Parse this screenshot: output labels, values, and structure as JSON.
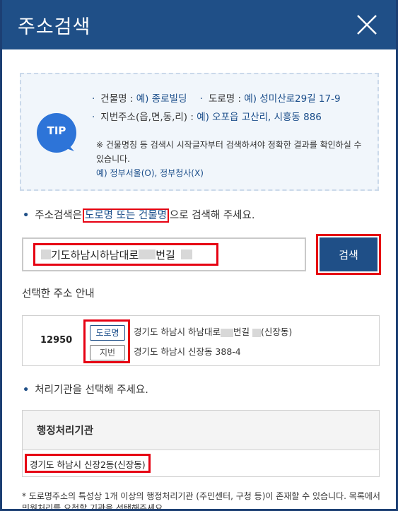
{
  "header": {
    "title": "주소검색"
  },
  "tip": {
    "badge": "TIP",
    "line1_label1": "건물명 :",
    "line1_ex1": "예) 종로빌딩",
    "line1_label2": "도로명 :",
    "line1_ex2": "예) 성미산로29길 17-9",
    "line2_label": "지번주소(읍,면,동,리) :",
    "line2_ex": "예) 오포읍 고산리, 시흥동 886",
    "note": "※ 건물명칭 등 검색시 시작글자부터 검색하셔야 정확한 결과를 확인하실 수 있습니다.",
    "example": "예) 정부서울(O), 정부청사(X)"
  },
  "guide": {
    "prefix": "주소검색은",
    "highlight": "도로명 또는 건물명",
    "suffix": "으로 검색해 주세요."
  },
  "search": {
    "value_a": "기도하남시하남대로",
    "value_b": "번길",
    "button_label": "검색"
  },
  "selected": {
    "title": "선택한 주소 안내",
    "zip": "12950",
    "road_tag": "도로명",
    "lot_tag": "지번",
    "road_addr_a": "경기도 하남시 하남대로",
    "road_addr_b": "번길",
    "road_addr_c": "(신장동)",
    "lot_addr": "경기도 하남시 신장동 388-4"
  },
  "agency": {
    "prompt": "처리기관을 선택해 주세요.",
    "header": "행정처리기관",
    "item": "경기도 하남시 신장2동(신장동)"
  },
  "footnote": "* 도로명주소의 특성상 1개 이상의 행정처리기관 (주민센터, 구청 등)이 존재할 수 있습니다. 목록에서 민원처리를 요청할 기관을 선택해주세요."
}
